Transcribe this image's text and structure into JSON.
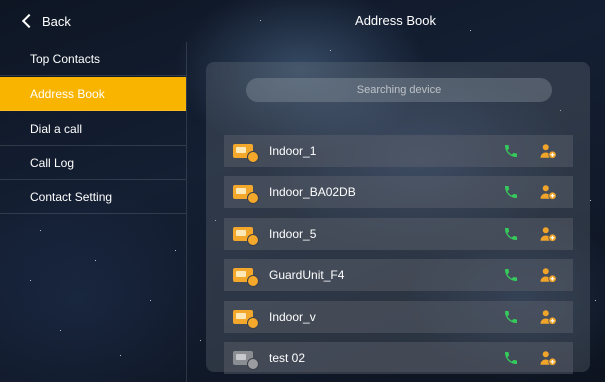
{
  "header": {
    "back_label": "Back",
    "title": "Address Book"
  },
  "sidebar": {
    "items": [
      {
        "label": "Top Contacts"
      },
      {
        "label": "Address Book"
      },
      {
        "label": "Dial a call"
      },
      {
        "label": "Call Log"
      },
      {
        "label": "Contact Setting"
      }
    ],
    "active_index": 1,
    "active_color": "#f9b400"
  },
  "search": {
    "text": "Searching device"
  },
  "devices": [
    {
      "name": "Indoor_1",
      "online": true
    },
    {
      "name": "Indoor_BA02DB",
      "online": true
    },
    {
      "name": "Indoor_5",
      "online": true
    },
    {
      "name": "GuardUnit_F4",
      "online": true
    },
    {
      "name": "Indoor_v",
      "online": true
    },
    {
      "name": "test 02",
      "online": false
    }
  ],
  "icons": {
    "back": "chevron-left-icon",
    "device": "indoor-monitor-icon",
    "call": "phone-icon",
    "add_contact": "add-contact-icon"
  },
  "colors": {
    "call_green": "#36c95b",
    "device_orange": "#f3a82b",
    "add_orange": "#f0a52a"
  }
}
